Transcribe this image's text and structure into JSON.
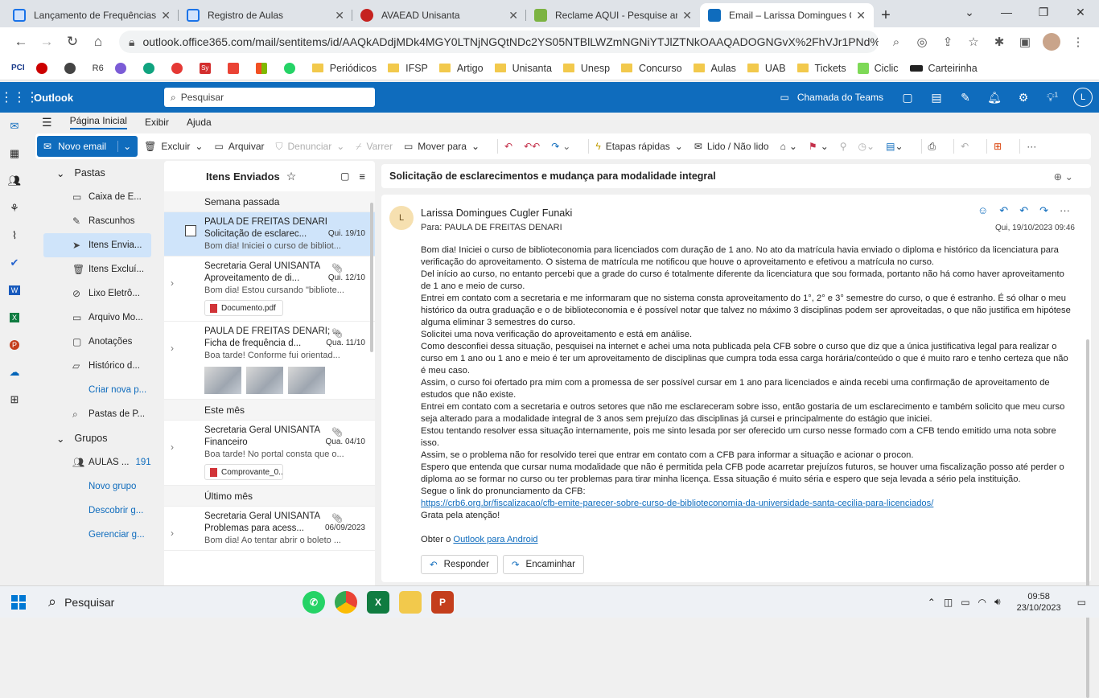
{
  "browser": {
    "tabs": [
      {
        "title": "Lançamento de Frequências",
        "color": "#1a73e8"
      },
      {
        "title": "Registro de Aulas",
        "color": "#1a73e8"
      },
      {
        "title": "AVAEAD Unisanta",
        "color": "#c5221f"
      },
      {
        "title": "Reclame AQUI - Pesquise an",
        "color": "#7cb342"
      },
      {
        "title": "Email – Larissa Domingues C",
        "color": "#0f6cbd"
      }
    ],
    "url": "outlook.office365.com/mail/sentitems/id/AAQkADdjMDk4MGY0LTNjNGQtNDc2YS05NTBlLWZmNGNiYTJlZTNkOAAQADOGNGvX%2FhVJr1PNd%2B...",
    "bookmarks": [
      "PCI",
      "",
      "",
      "R6",
      "",
      "",
      "",
      "Sy",
      "",
      "",
      "",
      "Periódicos",
      "IFSP",
      "Artigo",
      "Unisanta",
      "Unesp",
      "Concurso",
      "Aulas",
      "UAB",
      "Tickets",
      "Ciclic",
      "Carteirinha"
    ]
  },
  "outlook": {
    "brand": "Outlook",
    "search_placeholder": "Pesquisar",
    "teams_call": "Chamada do Teams",
    "user_initial": "L",
    "notification_count": "1"
  },
  "ribbon": {
    "tabs": [
      "Página Inicial",
      "Exibir",
      "Ajuda"
    ],
    "new_mail": "Novo email",
    "tools": {
      "delete": "Excluir",
      "archive": "Arquivar",
      "report": "Denunciar",
      "sweep": "Varrer",
      "move": "Mover para",
      "quick_steps": "Etapas rápidas",
      "read_unread": "Lido / Não lido"
    }
  },
  "folders": {
    "header": "Pastas",
    "items": [
      "Caixa de E...",
      "Rascunhos",
      "Itens Envia...",
      "Itens Excluí...",
      "Lixo Eletrô...",
      "Arquivo Mo...",
      "Anotações",
      "Histórico d..."
    ],
    "create": "Criar nova p...",
    "search_folders": "Pastas de P...",
    "groups_header": "Grupos",
    "group_name": "AULAS ...",
    "group_count": "191",
    "new_group": "Novo grupo",
    "discover": "Descobrir g...",
    "manage": "Gerenciar g..."
  },
  "list": {
    "title": "Itens Enviados",
    "groups": [
      "Semana passada",
      "Este mês",
      "Último mês"
    ],
    "items": [
      {
        "sender": "PAULA DE FREITAS DENARI",
        "subject": "Solicitação de esclarec...",
        "date": "Qui. 19/10",
        "preview": "Bom dia! Iniciei o curso de bibliot..."
      },
      {
        "sender": "Secretaria Geral UNISANTA",
        "subject": "Aproveitamento de di...",
        "date": "Qui. 12/10",
        "preview": "Bom dia! Estou cursando \"bibliote...",
        "attachment": "Documento.pdf"
      },
      {
        "sender": "PAULA DE FREITAS DENARI; ...",
        "subject": "Ficha de frequência d...",
        "date": "Qua. 11/10",
        "preview": "Boa tarde! Conforme fui orientad..."
      },
      {
        "sender": "Secretaria Geral UNISANTA",
        "subject": "Financeiro",
        "date": "Qua. 04/10",
        "preview": "Boa tarde! No portal consta que o...",
        "attachment": "Comprovante_0..."
      },
      {
        "sender": "Secretaria Geral UNISANTA",
        "subject": "Problemas para acess...",
        "date": "06/09/2023",
        "preview": "Bom dia! Ao tentar abrir o boleto ..."
      }
    ]
  },
  "message": {
    "subject": "Solicitação de esclarecimentos e mudança para modalidade integral",
    "from": "Larissa Domingues Cugler Funaki",
    "to": "Para:  PAULA DE FREITAS DENARI",
    "avatar": "L",
    "datetime": "Qui, 19/10/2023 09:46",
    "paragraphs": [
      "Bom dia! Iniciei o curso de biblioteconomia para licenciados com duração de 1 ano. No ato da matrícula havia enviado o diploma e histórico da licenciatura para verificação do aproveitamento. O sistema de matrícula me notificou que houve o aproveitamento e efetivou a matrícula no curso.",
      "Del início ao curso, no entanto percebi que a grade do curso é totalmente diferente da licenciatura que sou formada, portanto não há como haver aproveitamento de 1 ano e meio de curso.",
      "Entrei em contato com a secretaria e me informaram que no sistema consta aproveitamento do 1°, 2° e 3° semestre do curso, o que é estranho. É só olhar o meu histórico da outra graduação e o de biblioteconomia e é possível notar que talvez no máximo 3 disciplinas podem ser aproveitadas, o que não justifica em hipótese alguma eliminar 3 semestres do curso.",
      "Solicitei uma nova verificação do aproveitamento e está em análise.",
      "Como desconfiei dessa situação, pesquisei na internet e achei uma nota publicada pela CFB sobre o curso que diz que a única justificativa legal para realizar o curso em 1 ano ou 1 ano e meio é ter um aproveitamento de disciplinas que cumpra toda essa carga horária/conteúdo o que é muito raro e tenho certeza que não é meu caso.",
      "Assim, o curso foi ofertado pra mim com a promessa de ser possível cursar em 1 ano para licenciados e ainda recebi uma confirmação de aproveitamento de estudos que não existe.",
      "Entrei em contato com a secretaria e outros setores que não me esclareceram sobre isso, então gostaria de um esclarecimento e também solicito que meu curso seja alterado para a modalidade integral de 3 anos sem prejuízo das disciplinas já cursei e principalmente do estágio que iniciei.",
      "Estou tentando resolver essa situação internamente, pois me sinto lesada por ser oferecido um curso nesse formado com a CFB tendo emitido uma nota sobre isso.",
      "Assim, se o problema não for resolvido terei que entrar em contato com a CFB para informar a situação e acionar o procon.",
      "Espero que entenda que cursar numa modalidade que não é permitida pela CFB pode acarretar prejuízos futuros, se houver uma fiscalização posso até perder o diploma ao se formar no curso ou ter problemas para tirar minha licença. Essa situação é muito séria e espero que seja levada a sério pela instituição.",
      "Segue o link do pronunciamento da CFB:"
    ],
    "link": "https://crb6.org.br/fiscalizacao/cfb-emite-parecer-sobre-curso-de-biblioteconomia-da-universidade-santa-cecilia-para-licenciados/",
    "closing": "Grata pela atenção!",
    "signature_prefix": "Obter o ",
    "signature_link": "Outlook para Android",
    "reply": "Responder",
    "forward": "Encaminhar"
  },
  "taskbar": {
    "search": "Pesquisar",
    "time": "09:58",
    "date": "23/10/2023"
  }
}
